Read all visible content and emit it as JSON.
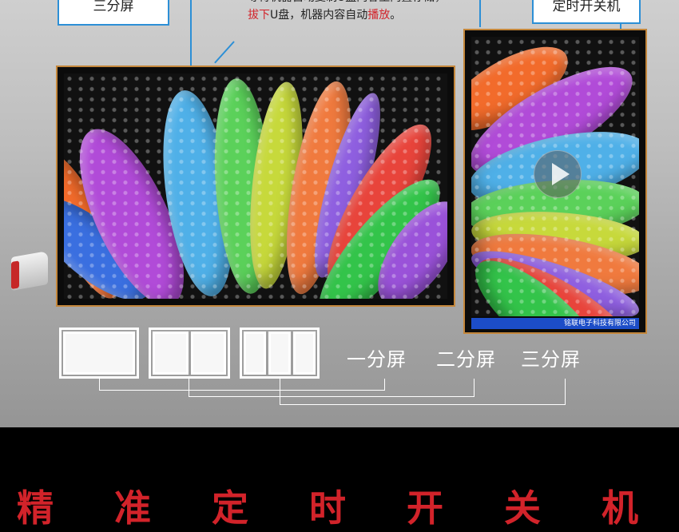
{
  "callouts": {
    "left": "三分屏",
    "right": "定时开关机"
  },
  "note": {
    "line1": "等待机器自动复制U盘内容至内置存储，",
    "line2_red1": "拔下",
    "line2_mid": "U盘，机器内容自动",
    "line2_red2": "播放",
    "line2_end": "。"
  },
  "portrait_screen": {
    "company": "铭联电子科技有限公司"
  },
  "split_modes": [
    {
      "label": "一分屏"
    },
    {
      "label": "二分屏"
    },
    {
      "label": "三分屏"
    }
  ],
  "bottom": {
    "title": "精  准  定  时  开  关  机"
  },
  "colors": {
    "callout_border": "#2c8fd6",
    "frame": "#c4873b",
    "accent_red": "#d2232a",
    "banner_blue": "#1c4dc8"
  }
}
